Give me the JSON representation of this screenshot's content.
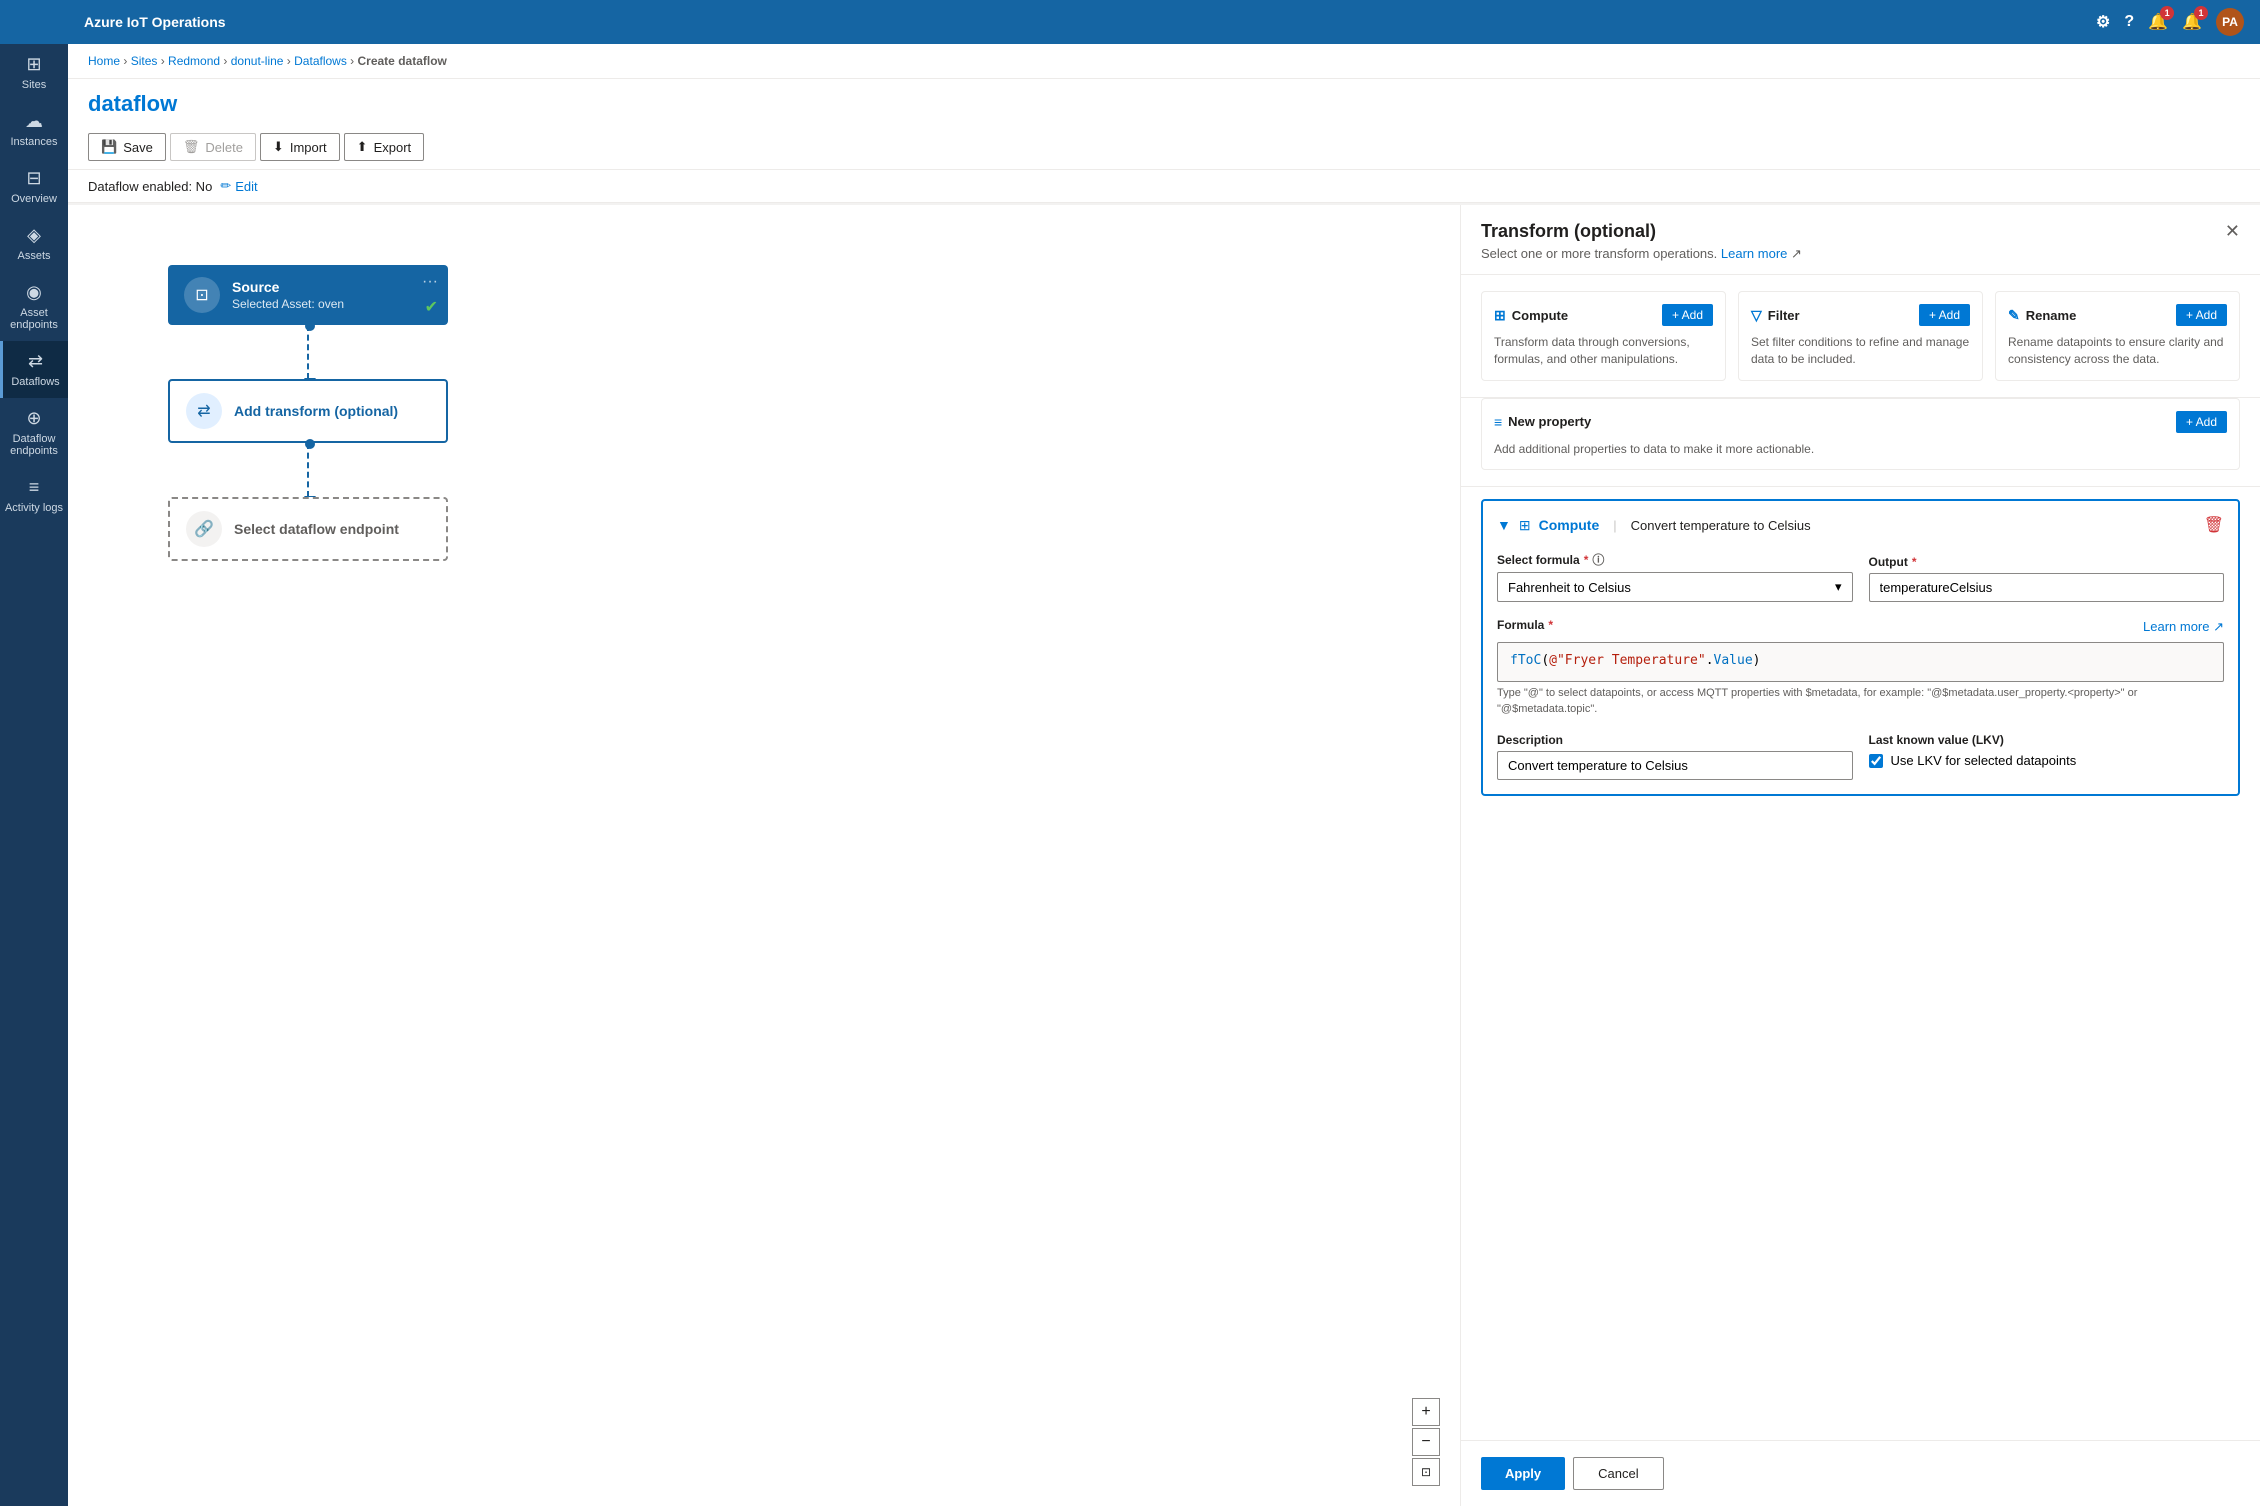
{
  "app": {
    "title": "Azure IoT Operations"
  },
  "topbar": {
    "settings_icon": "⚙",
    "help_icon": "?",
    "bell_icon": "🔔",
    "alert_icon": "🔔",
    "bell_count": "1",
    "alert_count": "1",
    "avatar": "PA"
  },
  "sidebar": {
    "items": [
      {
        "id": "sites",
        "label": "Sites",
        "icon": "⊞"
      },
      {
        "id": "instances",
        "label": "Instances",
        "icon": "☁"
      },
      {
        "id": "overview",
        "label": "Overview",
        "icon": "⊟"
      },
      {
        "id": "assets",
        "label": "Assets",
        "icon": "◈"
      },
      {
        "id": "asset-endpoints",
        "label": "Asset endpoints",
        "icon": "◉"
      },
      {
        "id": "dataflows",
        "label": "Dataflows",
        "icon": "⇄",
        "active": true
      },
      {
        "id": "dataflow-endpoints",
        "label": "Dataflow endpoints",
        "icon": "⊕"
      },
      {
        "id": "activity-logs",
        "label": "Activity logs",
        "icon": "≡"
      }
    ]
  },
  "breadcrumb": {
    "items": [
      "Home",
      "Sites",
      "Redmond",
      "donut-line",
      "Dataflows"
    ],
    "current": "Create dataflow"
  },
  "page": {
    "title": "dataflow",
    "status": "Dataflow enabled: No"
  },
  "toolbar": {
    "save": "Save",
    "delete": "Delete",
    "import": "Import",
    "export": "Export"
  },
  "panel": {
    "title": "Transform (optional)",
    "subtitle": "Select one or more transform operations.",
    "learn_more": "Learn more",
    "operations": [
      {
        "id": "compute",
        "icon": "⊞",
        "title": "Compute",
        "add_label": "+ Add",
        "description": "Transform data through conversions, formulas, and other manipulations."
      },
      {
        "id": "filter",
        "icon": "▽",
        "title": "Filter",
        "add_label": "+ Add",
        "description": "Set filter conditions to refine and manage data to be included."
      },
      {
        "id": "rename",
        "icon": "✎",
        "title": "Rename",
        "add_label": "+ Add",
        "description": "Rename datapoints to ensure clarity and consistency across the data."
      }
    ],
    "new_property": {
      "icon": "≡",
      "title": "New property",
      "add_label": "+ Add",
      "description": "Add additional properties to data to make it more actionable."
    }
  },
  "compute_card": {
    "title": "Compute",
    "subtitle": "Convert temperature to Celsius",
    "select_formula_label": "Select formula",
    "formula_value": "Fahrenheit to Celsius",
    "output_label": "Output",
    "output_value": "temperatureCelsius",
    "formula_label": "Formula",
    "learn_more": "Learn more",
    "formula_text": "fToC(@\"Fryer Temperature\".Value)",
    "formula_hint": "Type \"@\" to select datapoints, or access MQTT properties with $metadata, for example: \"@$metadata.user_property.<property>\" or \"@$metadata.topic\".",
    "description_label": "Description",
    "description_value": "Convert temperature to Celsius",
    "lkv_label": "Last known value (LKV)",
    "lkv_checkbox_label": "Use LKV for selected datapoints",
    "lkv_checked": true
  },
  "footer": {
    "apply": "Apply",
    "cancel": "Cancel"
  },
  "canvas": {
    "nodes": [
      {
        "id": "source",
        "type": "source",
        "title": "Source",
        "subtitle": "Selected Asset: oven"
      },
      {
        "id": "transform",
        "type": "transform",
        "title": "Add transform (optional)",
        "subtitle": ""
      },
      {
        "id": "endpoint",
        "type": "endpoint",
        "title": "Select dataflow endpoint",
        "subtitle": ""
      }
    ]
  }
}
